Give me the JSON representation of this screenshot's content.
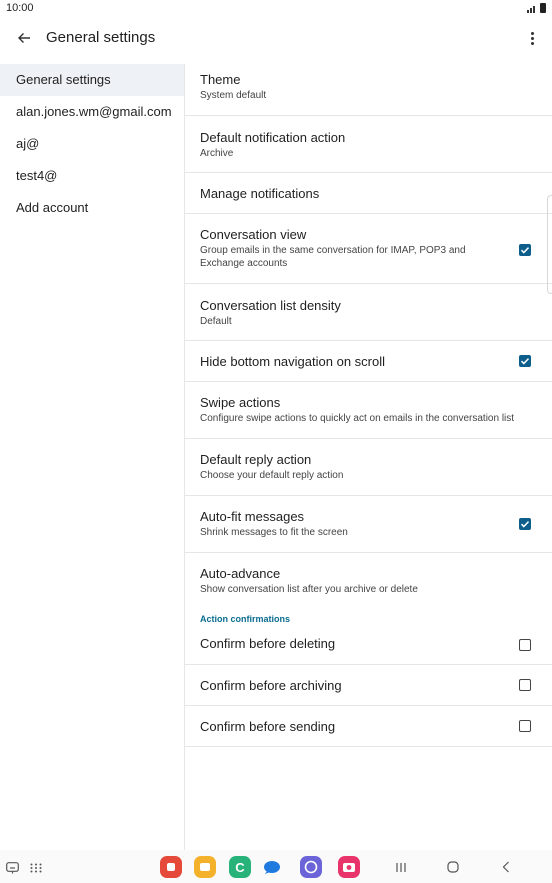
{
  "status_bar": {
    "time": "10:00"
  },
  "app_bar": {
    "title": "General settings"
  },
  "accounts": [
    {
      "label": "General settings",
      "active": true
    },
    {
      "label": "alan.jones.wm@gmail.com",
      "active": false
    },
    {
      "label": "aj@",
      "active": false
    },
    {
      "label": "test4@",
      "active": false
    },
    {
      "label": "Add account",
      "active": false
    }
  ],
  "settings": {
    "theme": {
      "title": "Theme",
      "subtitle": "System default"
    },
    "default_notification_action": {
      "title": "Default notification action",
      "subtitle": "Archive"
    },
    "manage_notifications": {
      "title": "Manage notifications"
    },
    "conversation_view": {
      "title": "Conversation view",
      "subtitle": "Group emails in the same conversation for IMAP, POP3 and Exchange accounts",
      "checked": true
    },
    "conversation_list_density": {
      "title": "Conversation list density",
      "subtitle": "Default"
    },
    "hide_bottom_navigation": {
      "title": "Hide bottom navigation on scroll",
      "checked": true
    },
    "swipe_actions": {
      "title": "Swipe actions",
      "subtitle": "Configure swipe actions to quickly act on emails in the conversation list"
    },
    "default_reply_action": {
      "title": "Default reply action",
      "subtitle": "Choose your default reply action"
    },
    "auto_fit_messages": {
      "title": "Auto-fit messages",
      "subtitle": "Shrink messages to fit the screen",
      "checked": true
    },
    "auto_advance": {
      "title": "Auto-advance",
      "subtitle": "Show conversation list after you archive or delete"
    }
  },
  "action_confirmations": {
    "header": "Action confirmations",
    "confirm_deleting": {
      "title": "Confirm before deleting",
      "checked": false
    },
    "confirm_archiving": {
      "title": "Confirm before archiving",
      "checked": false
    },
    "confirm_sending": {
      "title": "Confirm before sending",
      "checked": false
    }
  },
  "colors": {
    "accent": "#0e5e8c",
    "active_item_bg": "#eef1f6",
    "section_header": "#0b6d8f"
  },
  "nav_bar": {
    "icons": [
      "keyboard-icon",
      "apps-grid-icon",
      "app-red-icon",
      "app-yellow-icon",
      "phone-app-icon",
      "messages-app-icon",
      "internet-app-icon",
      "camera-app-icon",
      "recents-icon",
      "home-icon",
      "back-nav-icon"
    ]
  }
}
